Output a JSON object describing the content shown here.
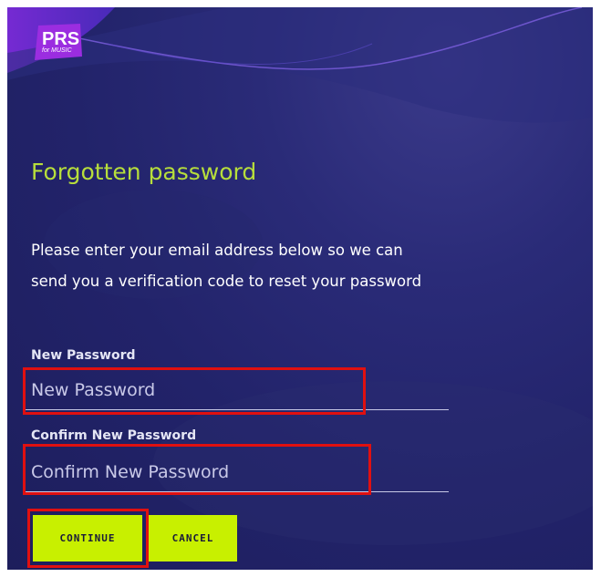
{
  "brand": {
    "name": "PRS",
    "tagline": "for MUSIC"
  },
  "page": {
    "title": "Forgotten password",
    "description": "Please enter your email address below so we can send you a verification code to reset your password"
  },
  "form": {
    "new_password": {
      "label": "New Password",
      "placeholder": "New Password",
      "value": ""
    },
    "confirm_password": {
      "label": "Confirm New Password",
      "placeholder": "Confirm New Password",
      "value": ""
    }
  },
  "actions": {
    "continue_label": "CONTINUE",
    "cancel_label": "CANCEL"
  },
  "colors": {
    "background": "#22236a",
    "accent": "#b7de3b",
    "button": "#c8f000",
    "highlight": "#e01010",
    "logo": "#8a2be2"
  }
}
